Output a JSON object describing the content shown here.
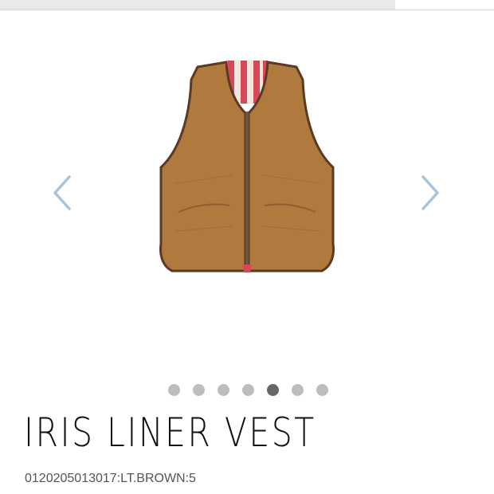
{
  "product": {
    "name": "IRIS LINER VEST",
    "sku": "0120205013017:LT.BROWN:5",
    "image_icon": "vest-image"
  },
  "carousel": {
    "prev_icon": "chevron-left-icon",
    "next_icon": "chevron-right-icon",
    "slide_count": 7,
    "active_slide": 5
  },
  "colors": {
    "arrow": "#a9c4d6",
    "dot": "#bdbdbd",
    "dot_active": "#666666",
    "vest_body": "#b07a3e",
    "vest_trim": "#5a3a22",
    "lining_red": "#d64a55"
  }
}
